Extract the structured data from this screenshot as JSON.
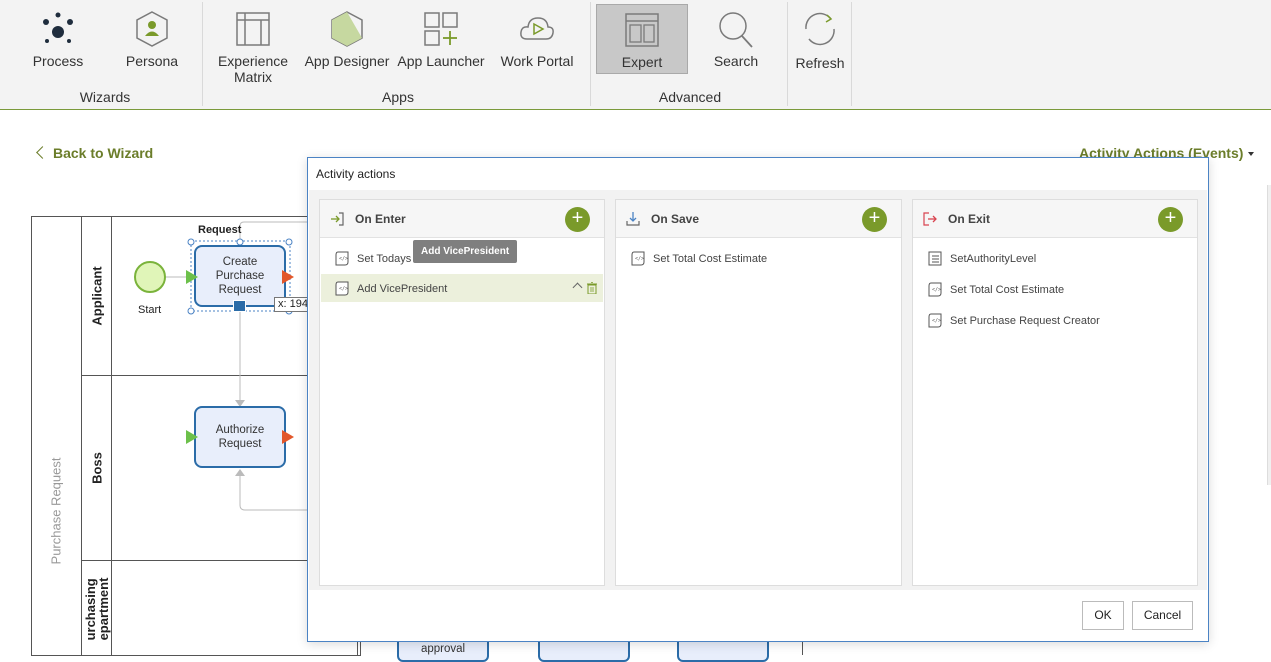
{
  "ribbon": {
    "groups": [
      {
        "label": "Wizards"
      },
      {
        "label": "Apps"
      },
      {
        "label": "Advanced"
      }
    ],
    "buttons": [
      {
        "label": "Process",
        "icon": "process-icon"
      },
      {
        "label": "Persona",
        "icon": "persona-icon"
      },
      {
        "label": "Experience\nMatrix",
        "icon": "experience-matrix-icon"
      },
      {
        "label": "App Designer",
        "icon": "app-designer-icon"
      },
      {
        "label": "App Launcher",
        "icon": "app-launcher-icon"
      },
      {
        "label": "Work Portal",
        "icon": "work-portal-icon"
      },
      {
        "label": "Expert",
        "icon": "expert-icon"
      },
      {
        "label": "Search",
        "icon": "search-icon"
      },
      {
        "label": "Refresh",
        "icon": "refresh-icon"
      }
    ]
  },
  "page": {
    "back_label": "Back to Wizard",
    "events_label": "Activity Actions (Events)"
  },
  "diagram": {
    "pool_label": "Purchase Request",
    "lanes": [
      "Applicant",
      "Boss",
      "urchasing\nepartment"
    ],
    "start_label": "Start",
    "request_label": "Request",
    "tasks": [
      "Create\nPurchase\nRequest",
      "Authorize\nRequest",
      "approval"
    ],
    "coord_readout": "x: 194"
  },
  "dialog": {
    "title": "Activity actions",
    "ok_label": "OK",
    "cancel_label": "Cancel",
    "tooltip": "Add VicePresident",
    "panels": [
      {
        "title": "On Enter",
        "icon": "enter-icon",
        "items": [
          "Set Todays D",
          "Add VicePresident"
        ]
      },
      {
        "title": "On Save",
        "icon": "save-icon",
        "items": [
          "Set Total Cost Estimate"
        ]
      },
      {
        "title": "On Exit",
        "icon": "exit-icon",
        "items": [
          "SetAuthorityLevel",
          "Set Total Cost Estimate",
          "Set Purchase Request Creator"
        ]
      }
    ]
  },
  "colors": {
    "accent_green": "#7a9a2a",
    "link_green": "#6b7d2a",
    "task_border": "#2b6ca8",
    "dialog_border": "#4b83c4"
  }
}
